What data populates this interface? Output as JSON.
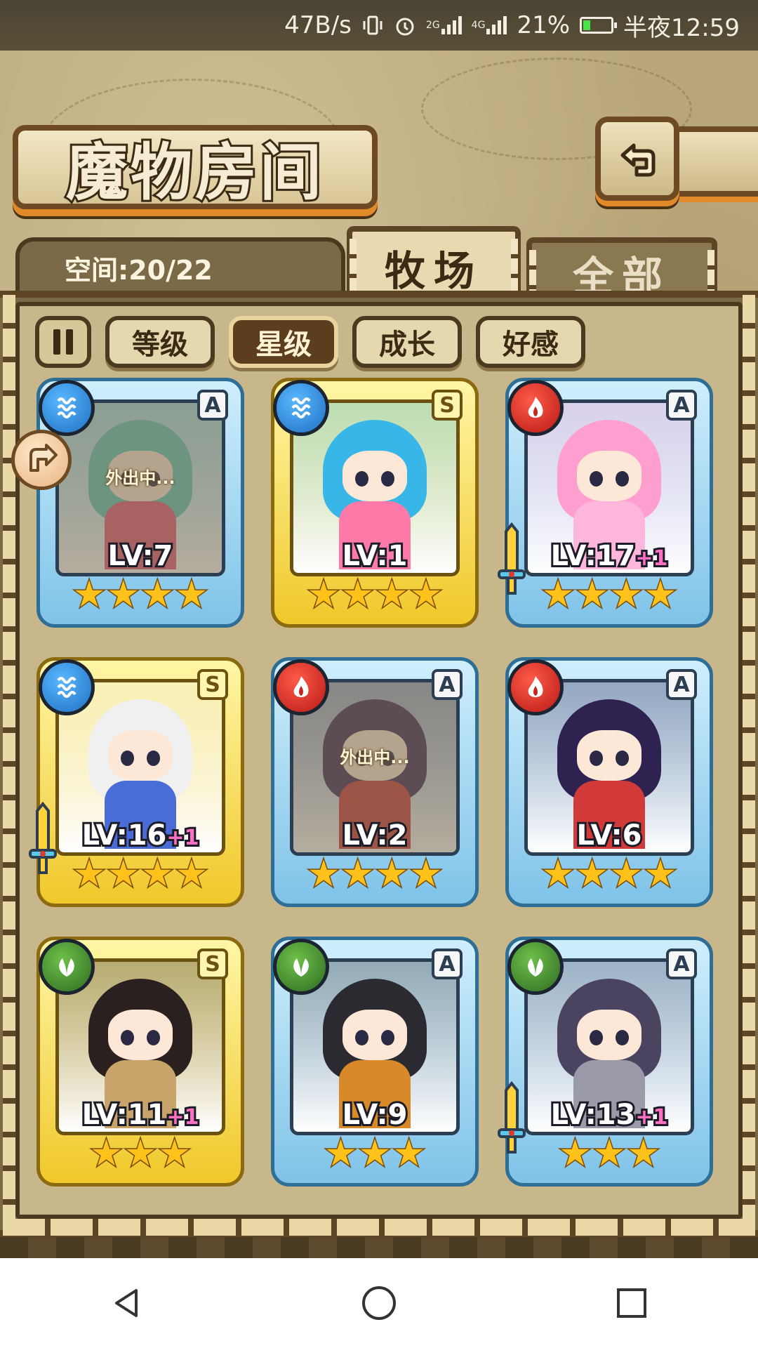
{
  "status_bar": {
    "speed": "47B/s",
    "net1": "2G",
    "net2": "4G",
    "battery": "21%",
    "time": "半夜12:59"
  },
  "header": {
    "title": "魔物房间",
    "back_icon": "return-arrow-icon"
  },
  "space": {
    "label": "空间:20/22"
  },
  "tabs": [
    {
      "label": "牧场",
      "active": true
    },
    {
      "label": "全部",
      "active": false
    }
  ],
  "filters": [
    {
      "label": "等级",
      "active": false
    },
    {
      "label": "星级",
      "active": true
    },
    {
      "label": "成长",
      "active": false
    },
    {
      "label": "好感",
      "active": false
    }
  ],
  "colors": {
    "water": "#1f6fc2",
    "fire": "#b81a14",
    "wood": "#2f6b22",
    "rank_a_frame": "#7fc3e8",
    "rank_s_frame": "#f0c82a",
    "star": "#ffc21a",
    "plus": "#ff6fc2"
  },
  "monsters": [
    {
      "element": "water",
      "rank": "A",
      "level": "LV:7",
      "plus": "",
      "stars": 4,
      "status": "外出中...",
      "weapon": false,
      "hair": "#5ec7b8",
      "body": "#e35a78"
    },
    {
      "element": "water",
      "rank": "S",
      "level": "LV:1",
      "plus": "",
      "stars": 4,
      "status": "",
      "weapon": false,
      "hair": "#38b6e8",
      "body": "#ff7aa8"
    },
    {
      "element": "fire",
      "rank": "A",
      "level": "LV:17",
      "plus": "+1",
      "stars": 4,
      "status": "",
      "weapon": true,
      "hair": "#ff9fd0",
      "body": "#ffb6dc"
    },
    {
      "element": "water",
      "rank": "S",
      "level": "LV:16",
      "plus": "+1",
      "stars": 4,
      "status": "",
      "weapon": true,
      "hair": "#f0f0f0",
      "body": "#4a6cd6"
    },
    {
      "element": "fire",
      "rank": "A",
      "level": "LV:2",
      "plus": "",
      "stars": 4,
      "status": "外出中...",
      "weapon": false,
      "hair": "#3a2a5a",
      "body": "#c83a3a"
    },
    {
      "element": "fire",
      "rank": "A",
      "level": "LV:6",
      "plus": "",
      "stars": 4,
      "status": "",
      "weapon": false,
      "hair": "#2e2250",
      "body": "#d23a3a"
    },
    {
      "element": "wood",
      "rank": "S",
      "level": "LV:11",
      "plus": "+1",
      "stars": 3,
      "status": "",
      "weapon": false,
      "hair": "#2a2020",
      "body": "#c9a46a"
    },
    {
      "element": "wood",
      "rank": "A",
      "level": "LV:9",
      "plus": "",
      "stars": 3,
      "status": "",
      "weapon": false,
      "hair": "#2a2a30",
      "body": "#d88a2a"
    },
    {
      "element": "wood",
      "rank": "A",
      "level": "LV:13",
      "plus": "+1",
      "stars": 3,
      "status": "",
      "weapon": true,
      "hair": "#4a4460",
      "body": "#9a9aa8"
    }
  ],
  "navbar": [
    "back-icon",
    "home-icon",
    "recents-icon"
  ]
}
